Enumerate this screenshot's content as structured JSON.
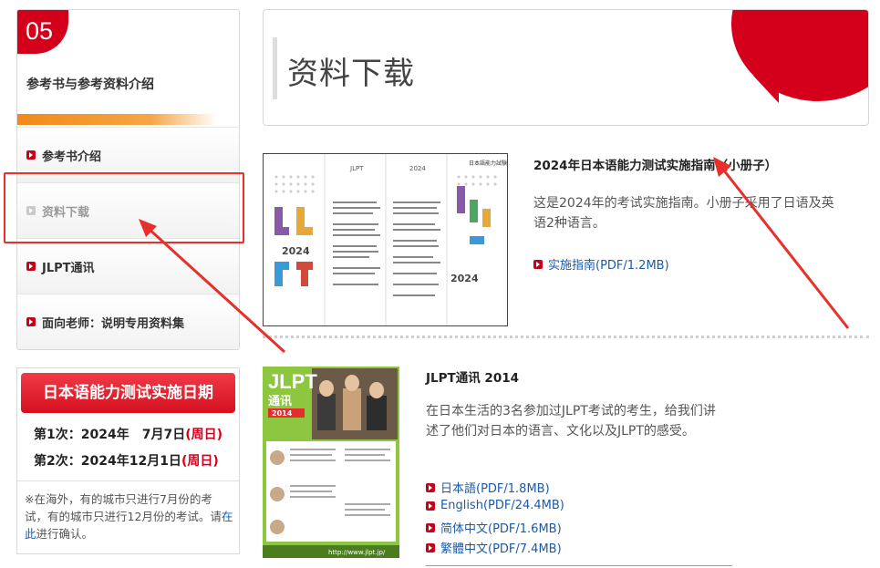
{
  "sidebar": {
    "section_number": "05",
    "title": "参考书与参考资料介绍",
    "items": [
      {
        "label": "参考书介绍"
      },
      {
        "label": "资料下载"
      },
      {
        "label": "JLPT通讯"
      },
      {
        "label": "面向老师：说明专用资料集"
      }
    ]
  },
  "exam_dates": {
    "banner": "日本语能力测试实施日期",
    "first_label": "第1次：2024年　7月7日",
    "first_dow": "(周日)",
    "second_label": "第2次：2024年12月1日",
    "second_dow": "(周日)",
    "note_before": "※在海外，有的城市只进行7月份的考试，有的城市只进行12月份的考试。请",
    "note_link": "在此",
    "note_after": "进行确认。"
  },
  "header": {
    "title": "资料下载"
  },
  "items": [
    {
      "title": "2024年日本语能力测试实施指南（小册子）",
      "description": "这是2024年的考试实施指南。小册子采用了日语及英语2种语言。",
      "links": [
        {
          "label": "实施指南(PDF/1.2MB)"
        }
      ],
      "thumb_text": {
        "brand": "JLPT",
        "year": "2024",
        "logo": "日本語能力試験"
      }
    },
    {
      "title": "JLPT通讯 2014",
      "description": "在日本生活的3名参加过JLPT考试的考生，给我们讲述了他们对日本的语言、文化以及JLPT的感受。",
      "links": [
        {
          "label": "日本語(PDF/1.8MB)"
        },
        {
          "label": "English(PDF/24.4MB)"
        },
        {
          "label": "简体中文(PDF/1.6MB)"
        },
        {
          "label": "繁體中文(PDF/7.4MB)"
        }
      ],
      "thumb_text": {
        "brand": "JLPT",
        "sub": "通讯",
        "year": "2014",
        "url": "http://www.jlpt.jp/"
      }
    }
  ],
  "colors": {
    "accent_red": "#d4001b",
    "link_blue": "#1a5aa8",
    "annotation_red": "#e8302a",
    "stripe_orange": "#f08a1a"
  }
}
